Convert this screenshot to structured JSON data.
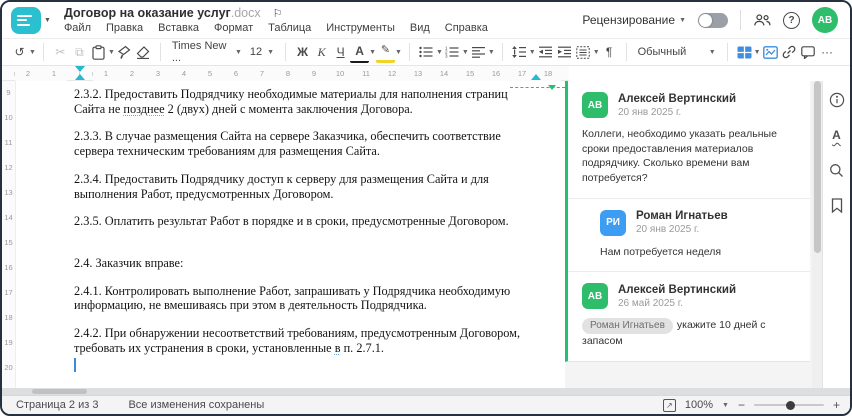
{
  "header": {
    "title": "Договор на оказание услуг",
    "title_ext": ".docx",
    "flag_glyph": "⚐",
    "menu_items": [
      "Файл",
      "Правка",
      "Вставка",
      "Формат",
      "Таблица",
      "Инструменты",
      "Вид",
      "Справка"
    ],
    "review_label": "Рецензирование",
    "help_glyph": "?",
    "avatar_initials": "АВ"
  },
  "toolbar": {
    "font_name": "Times New ...",
    "font_size": "12",
    "style_name": "Обычный",
    "glyphs": {
      "undo": "↺",
      "cut": "✂",
      "copy": "⧉",
      "bold": "Ж",
      "italic": "К",
      "underline": "Ч",
      "font_color": "А",
      "highlight": "✎",
      "pilcrow": "¶",
      "more": "···"
    }
  },
  "ruler": {
    "left_numbers": [
      "2",
      "1"
    ],
    "numbers": [
      "1",
      "2",
      "3",
      "4",
      "5",
      "6",
      "7",
      "8",
      "9",
      "10",
      "11",
      "12",
      "13",
      "14",
      "15",
      "16",
      "17",
      "18"
    ],
    "vertical_numbers": [
      "9",
      "10",
      "11",
      "12",
      "13",
      "14",
      "15",
      "16",
      "17",
      "18",
      "19",
      "20"
    ]
  },
  "document": {
    "paragraphs": [
      {
        "segments": [
          {
            "text": "2.3.2. Предоставить Подрядчику необходимые материалы для наполнения страниц Сайта не "
          },
          {
            "text": "позднее",
            "style": "spell"
          },
          {
            "text": " 2 (двух) дней с момента заключения Договора."
          }
        ]
      },
      {
        "segments": [
          {
            "text": "2.3.3. В случае размещения Сайта на сервере Заказчика, обеспечить соответствие сервера техническим требованиям для размещения Сайта."
          }
        ]
      },
      {
        "segments": [
          {
            "text": "2.3.4. Предоставить Подрядчику доступ к серверу для размещения Сайта и для выполнения Работ, предусмотренных Договором."
          }
        ]
      },
      {
        "segments": [
          {
            "text": "2.3.5. Оплатить результат Работ в порядке и в сроки, предусмотренные Договором."
          }
        ]
      },
      {
        "gap_before": true,
        "segments": [
          {
            "text": "2.4. Заказчик вправе:"
          }
        ]
      },
      {
        "segments": [
          {
            "text": "2.4.1. Контролировать выполнение Работ, запрашивать у Подрядчика необходимую информацию, не вмешиваясь при этом в деятельность Подрядчика."
          }
        ]
      },
      {
        "segments": [
          {
            "text": "2.4.2. При обнаружении несоответствий требованиям, предусмотренным Договором, требовать их устранения в сроки, установленные "
          },
          {
            "text": "в",
            "style": "spell"
          },
          {
            "text": " п. 2.7.1."
          }
        ]
      }
    ]
  },
  "comments": {
    "items": [
      {
        "initials": "АВ",
        "color": "#2ebd6b",
        "name": "Алексей Вертинский",
        "date": "20 янв 2025 г.",
        "text": "Коллеги, необходимо указать реальные сроки предоставления материалов подрядчику. Сколько времени вам потребуется?"
      },
      {
        "initials": "РИ",
        "color": "#3d9df3",
        "name": "Роман Игнатьев",
        "date": "20 янв 2025 г.",
        "indent": true,
        "text": "Нам потребуется неделя"
      },
      {
        "initials": "АВ",
        "color": "#2ebd6b",
        "name": "Алексей Вертинский",
        "date": "26 май 2025 г.",
        "mention": "Роман Игнатьев",
        "text": "укажите 10 дней с запасом"
      }
    ]
  },
  "statusbar": {
    "page_label": "Страница 2 из 3",
    "saved_label": "Все изменения сохранены",
    "zoom_value": "100%",
    "zoom_minus": "−",
    "zoom_plus": "+"
  },
  "colors": {
    "accent_teal": "#2bc0cf",
    "comment_green": "#22c272",
    "avatar_green": "#2ebd6b",
    "avatar_blue": "#3d9df3",
    "toolbar_blue": "#3f8fe0"
  }
}
